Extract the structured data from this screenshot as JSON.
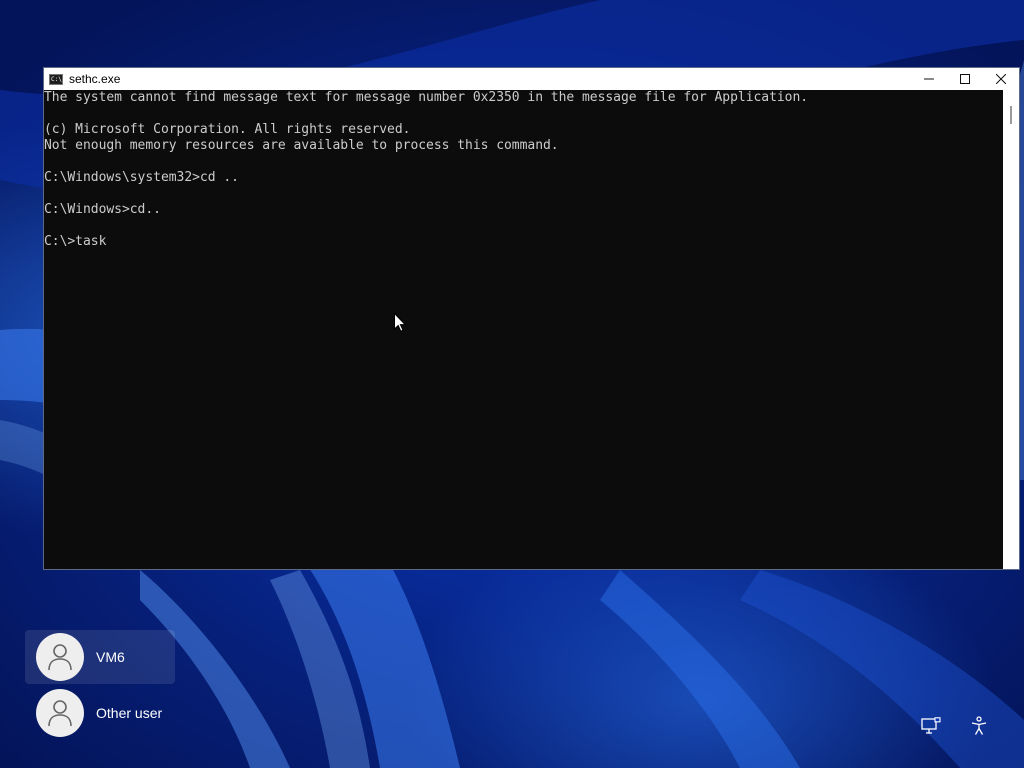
{
  "window": {
    "title": "sethc.exe",
    "icon": "cmd-icon",
    "controls": [
      "minimize-icon",
      "maximize-icon",
      "close-icon"
    ]
  },
  "console": {
    "lines": [
      "The system cannot find message text for message number 0x2350 in the message file for Application.",
      "",
      "(c) Microsoft Corporation. All rights reserved.",
      "Not enough memory resources are available to process this command.",
      "",
      "C:\\Windows\\system32>cd ..",
      "",
      "C:\\Windows>cd..",
      "",
      "C:\\>task"
    ]
  },
  "users": [
    {
      "name": "VM6",
      "selected": true
    },
    {
      "name": "Other user",
      "selected": false
    }
  ],
  "tray": [
    "network-icon",
    "accessibility-icon"
  ],
  "colors": {
    "console_bg": "#0c0c0c",
    "console_text": "#cccccc",
    "desktop_blue": "#0a36b8"
  }
}
